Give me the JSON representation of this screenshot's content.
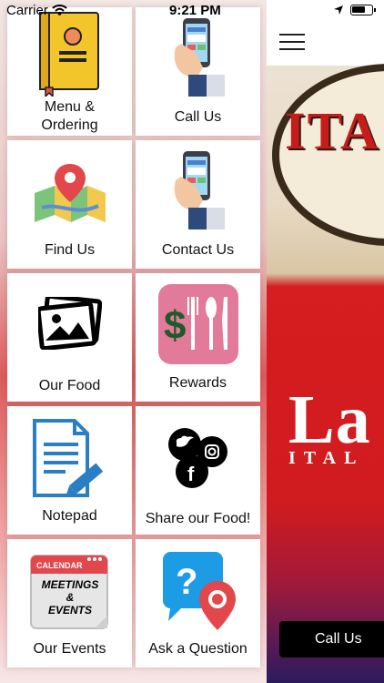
{
  "status_bar": {
    "carrier": "Carrier",
    "time": "9:21 PM"
  },
  "menu": {
    "items": [
      {
        "label_line1": "Menu &",
        "label_line2": "Ordering",
        "icon": "menu-book-icon"
      },
      {
        "label": "Call Us",
        "icon": "phone-hand-icon"
      },
      {
        "label": "Find Us",
        "icon": "map-pin-icon"
      },
      {
        "label": "Contact Us",
        "icon": "phone-hand-icon"
      },
      {
        "label": "Our Food",
        "icon": "photos-icon"
      },
      {
        "label": "Rewards",
        "icon": "dollar-cutlery-icon"
      },
      {
        "label": "Notepad",
        "icon": "notepad-pencil-icon"
      },
      {
        "label": "Share our Food!",
        "icon": "social-icons"
      },
      {
        "label": "Our Events",
        "icon": "calendar-icon"
      },
      {
        "label": "Ask a Question",
        "icon": "question-bubble-icon"
      }
    ],
    "calendar_header": "CALENDAR",
    "calendar_line1": "MEETINGS",
    "calendar_line2": "&",
    "calendar_line3": "EVENTS"
  },
  "main": {
    "logo_partial": "ITA",
    "brand_partial": "La",
    "brand_sub_partial": "ITAL",
    "call_button_label": "Call Us"
  },
  "colors": {
    "brand_red": "#d21b1e",
    "tile_bg": "#ffffff",
    "rewards_pink": "#e27a9a",
    "social_black": "#000000"
  }
}
